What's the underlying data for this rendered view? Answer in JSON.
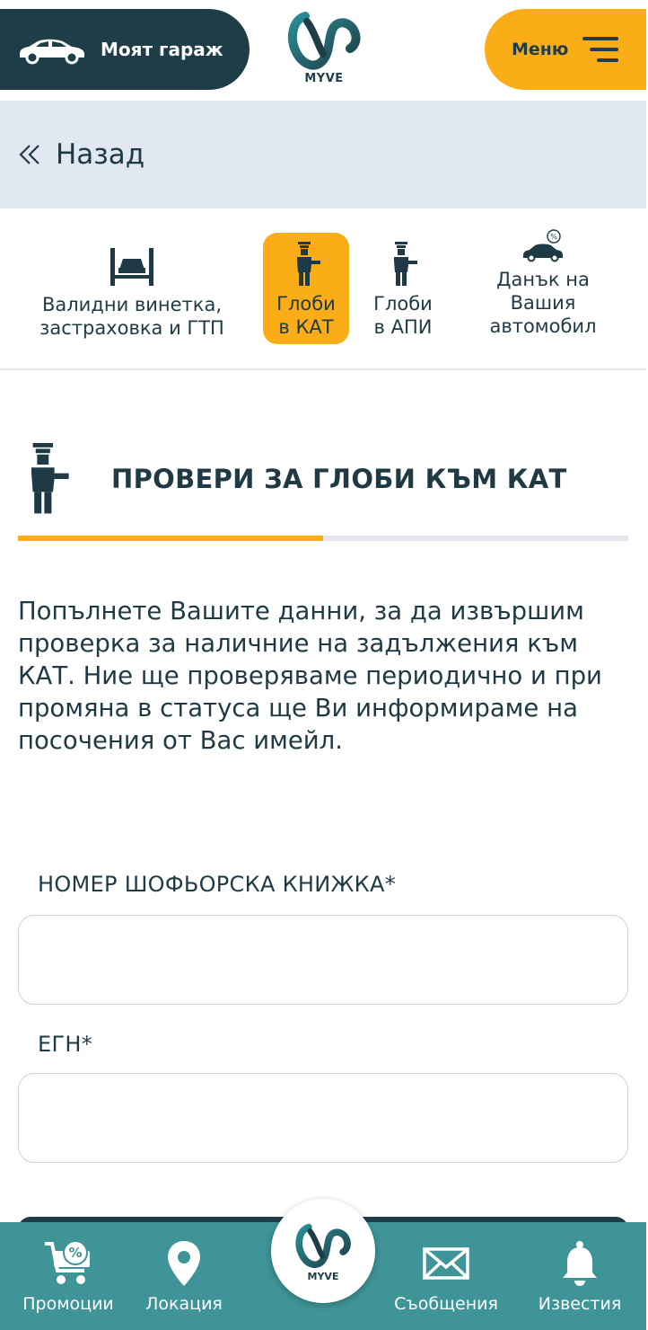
{
  "header": {
    "garage_label": "Моят гараж",
    "logo_text": "MYVE",
    "menu_label": "Меню"
  },
  "back": {
    "label": "Назад"
  },
  "categories": [
    {
      "label_line1": "Валидни винетка,",
      "label_line2": "застраховка и ГТП",
      "label_line3": "",
      "active": false
    },
    {
      "label_line1": "Глоби",
      "label_line2": "в КАТ",
      "label_line3": "",
      "active": true
    },
    {
      "label_line1": "Глоби",
      "label_line2": "в АПИ",
      "label_line3": "",
      "active": false
    },
    {
      "label_line1": "Данък на",
      "label_line2": "Вашия",
      "label_line3": "автомобил",
      "active": false
    }
  ],
  "section": {
    "title": "ПРОВЕРИ ЗА ГЛОБИ КЪМ КАТ",
    "progress_fraction": 0.5,
    "description": "Попълнете Вашите данни, за да извършим проверка за наличние на задължения към КАТ. Ние ще проверяваме периодично и при промяна в статуса ще Ви информираме на посочения от Вас имейл."
  },
  "form": {
    "license_label": "НОМЕР ШОФЬОРСКА КНИЖКА*",
    "license_value": "",
    "egn_label": "ЕГН*",
    "egn_value": ""
  },
  "bottom_nav": {
    "promotions": "Промоции",
    "location": "Локация",
    "logo_text": "MYVE",
    "messages": "Съобщения",
    "notifications": "Известия"
  },
  "colors": {
    "dark": "#1e3d47",
    "accent": "#fbad18",
    "back_bar": "#e2e8f1",
    "nav": "#3e9497"
  },
  "icons": [
    "car-icon",
    "myve-logo-icon",
    "hamburger-icon",
    "double-chevron-left-icon",
    "car-lift-icon",
    "traffic-officer-icon",
    "car-tax-icon",
    "cart-percent-icon",
    "location-pin-icon",
    "envelope-icon",
    "bell-icon"
  ]
}
